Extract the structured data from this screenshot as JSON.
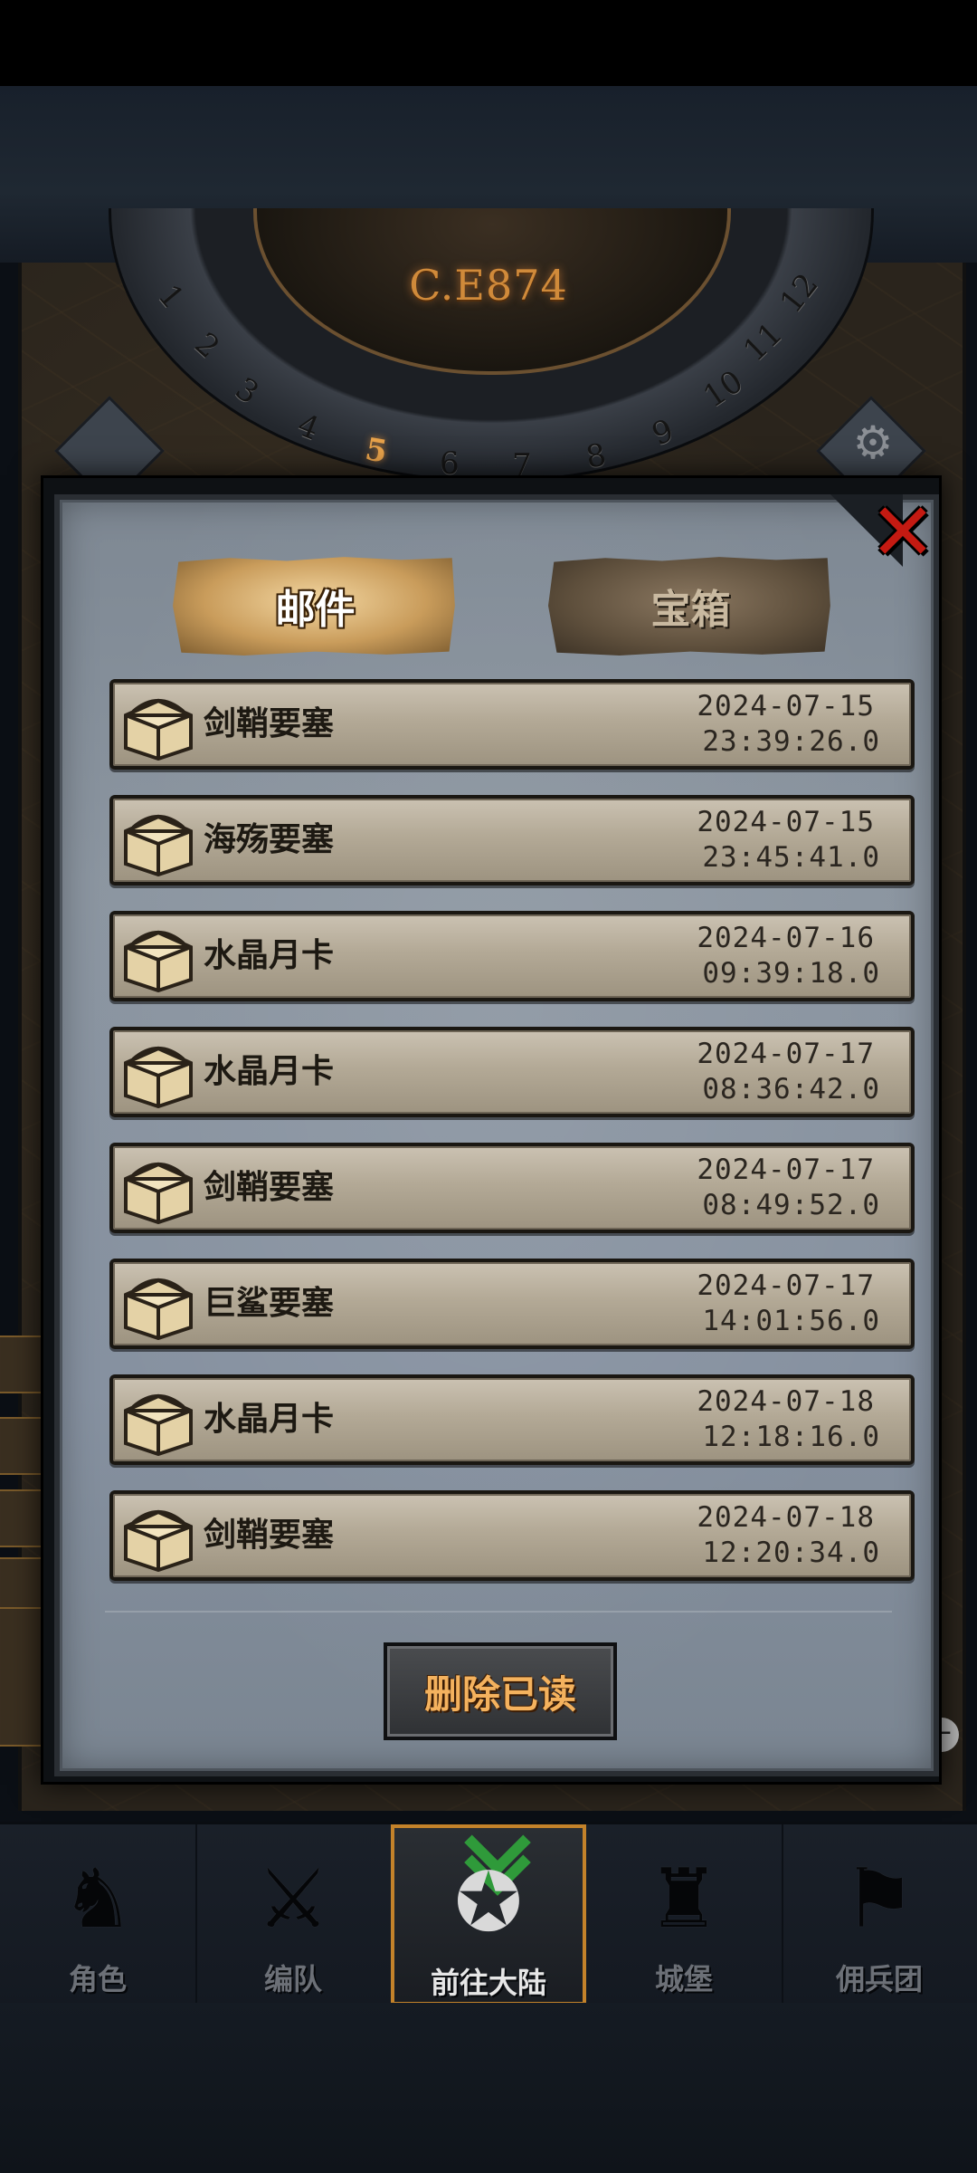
{
  "header": {
    "era_label": "C.E874",
    "calendar_months": [
      "1",
      "2",
      "3",
      "4",
      "5",
      "6",
      "7",
      "8",
      "9",
      "10",
      "11",
      "12"
    ],
    "current_month": "5"
  },
  "modal": {
    "tabs": [
      {
        "label": "邮件",
        "active": true
      },
      {
        "label": "宝箱",
        "active": false
      }
    ],
    "close_icon": "close-x-icon",
    "mails": [
      {
        "icon": "chest-icon",
        "title": "剑鞘要塞",
        "date": "2024-07-15",
        "time": "23:39:26.0"
      },
      {
        "icon": "chest-icon",
        "title": "海殇要塞",
        "date": "2024-07-15",
        "time": "23:45:41.0"
      },
      {
        "icon": "chest-icon",
        "title": "水晶月卡",
        "date": "2024-07-16",
        "time": "09:39:18.0"
      },
      {
        "icon": "chest-icon",
        "title": "水晶月卡",
        "date": "2024-07-17",
        "time": "08:36:42.0"
      },
      {
        "icon": "chest-icon",
        "title": "剑鞘要塞",
        "date": "2024-07-17",
        "time": "08:49:52.0"
      },
      {
        "icon": "chest-icon",
        "title": "巨鲨要塞",
        "date": "2024-07-17",
        "time": "14:01:56.0"
      },
      {
        "icon": "chest-icon",
        "title": "水晶月卡",
        "date": "2024-07-18",
        "time": "12:18:16.0"
      },
      {
        "icon": "chest-icon",
        "title": "剑鞘要塞",
        "date": "2024-07-18",
        "time": "12:20:34.0"
      }
    ],
    "delete_read_label": "删除已读"
  },
  "bottom_nav": {
    "items": [
      {
        "label": "角色",
        "icon": "knight-icon",
        "active": false
      },
      {
        "label": "编队",
        "icon": "formation-icon",
        "active": false
      },
      {
        "label": "前往大陆",
        "icon": "compass-icon",
        "active": true
      },
      {
        "label": "城堡",
        "icon": "castle-icon",
        "active": false
      },
      {
        "label": "佣兵团",
        "icon": "mercenary-icon",
        "active": false
      }
    ]
  },
  "colors": {
    "accent_gold": "#c3822a",
    "close_red": "#c41a12",
    "delete_text": "#f4b25e",
    "active_marker_green": "#2f9a3a"
  }
}
